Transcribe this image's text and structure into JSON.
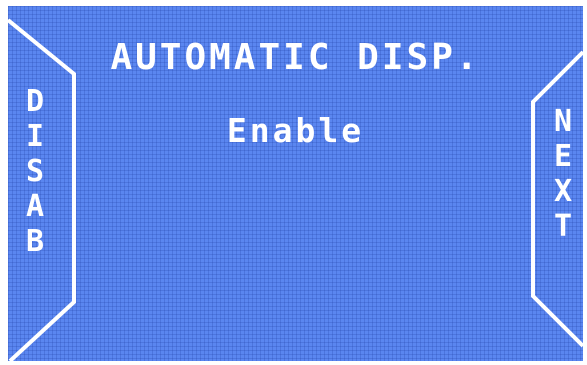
{
  "menu": {
    "title": "AUTOMATIC DISP.",
    "value": "Enable"
  },
  "softkeys": {
    "left_label": "DISAB",
    "right_label": "NEXT"
  },
  "colors": {
    "screen_background": "#5a86f0",
    "text": "#ffffff"
  }
}
